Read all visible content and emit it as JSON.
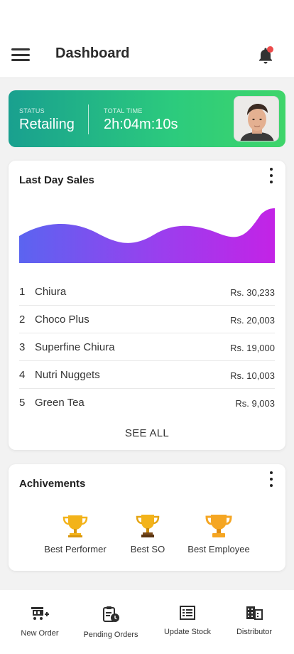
{
  "header": {
    "title": "Dashboard"
  },
  "status": {
    "status_label": "STATUS",
    "status_value": "Retailing",
    "time_label": "TOTAL TIME",
    "time_value": "2h:04m:10s"
  },
  "sales": {
    "title": "Last Day Sales",
    "items": [
      {
        "rank": "1",
        "name": "Chiura",
        "amount": "Rs. 30,233"
      },
      {
        "rank": "2",
        "name": "Choco Plus",
        "amount": "Rs. 20,003"
      },
      {
        "rank": "3",
        "name": "Superfine Chiura",
        "amount": "Rs. 19,000"
      },
      {
        "rank": "4",
        "name": "Nutri Nuggets",
        "amount": "Rs. 10,003"
      },
      {
        "rank": "5",
        "name": "Green Tea",
        "amount": "Rs. 9,003"
      }
    ],
    "see_all": "SEE ALL"
  },
  "achievements": {
    "title": "Achivements",
    "items": [
      {
        "label": "Best Performer"
      },
      {
        "label": "Best SO"
      },
      {
        "label": "Best Employee"
      }
    ]
  },
  "bottom_nav": [
    {
      "label": "New Order",
      "icon": "add-cart-icon"
    },
    {
      "label": "Pending Orders",
      "icon": "clipboard-clock-icon"
    },
    {
      "label": "Update Stock",
      "icon": "list-icon"
    },
    {
      "label": "Distributor",
      "icon": "building-icon"
    }
  ],
  "colors": {
    "status_gradient_start": "#19a08f",
    "status_gradient_end": "#3fd56a",
    "wave_start": "#5b64f0",
    "wave_end": "#c323e6",
    "notification_dot": "#ec4b4b",
    "trophy": "#f3b31a"
  }
}
